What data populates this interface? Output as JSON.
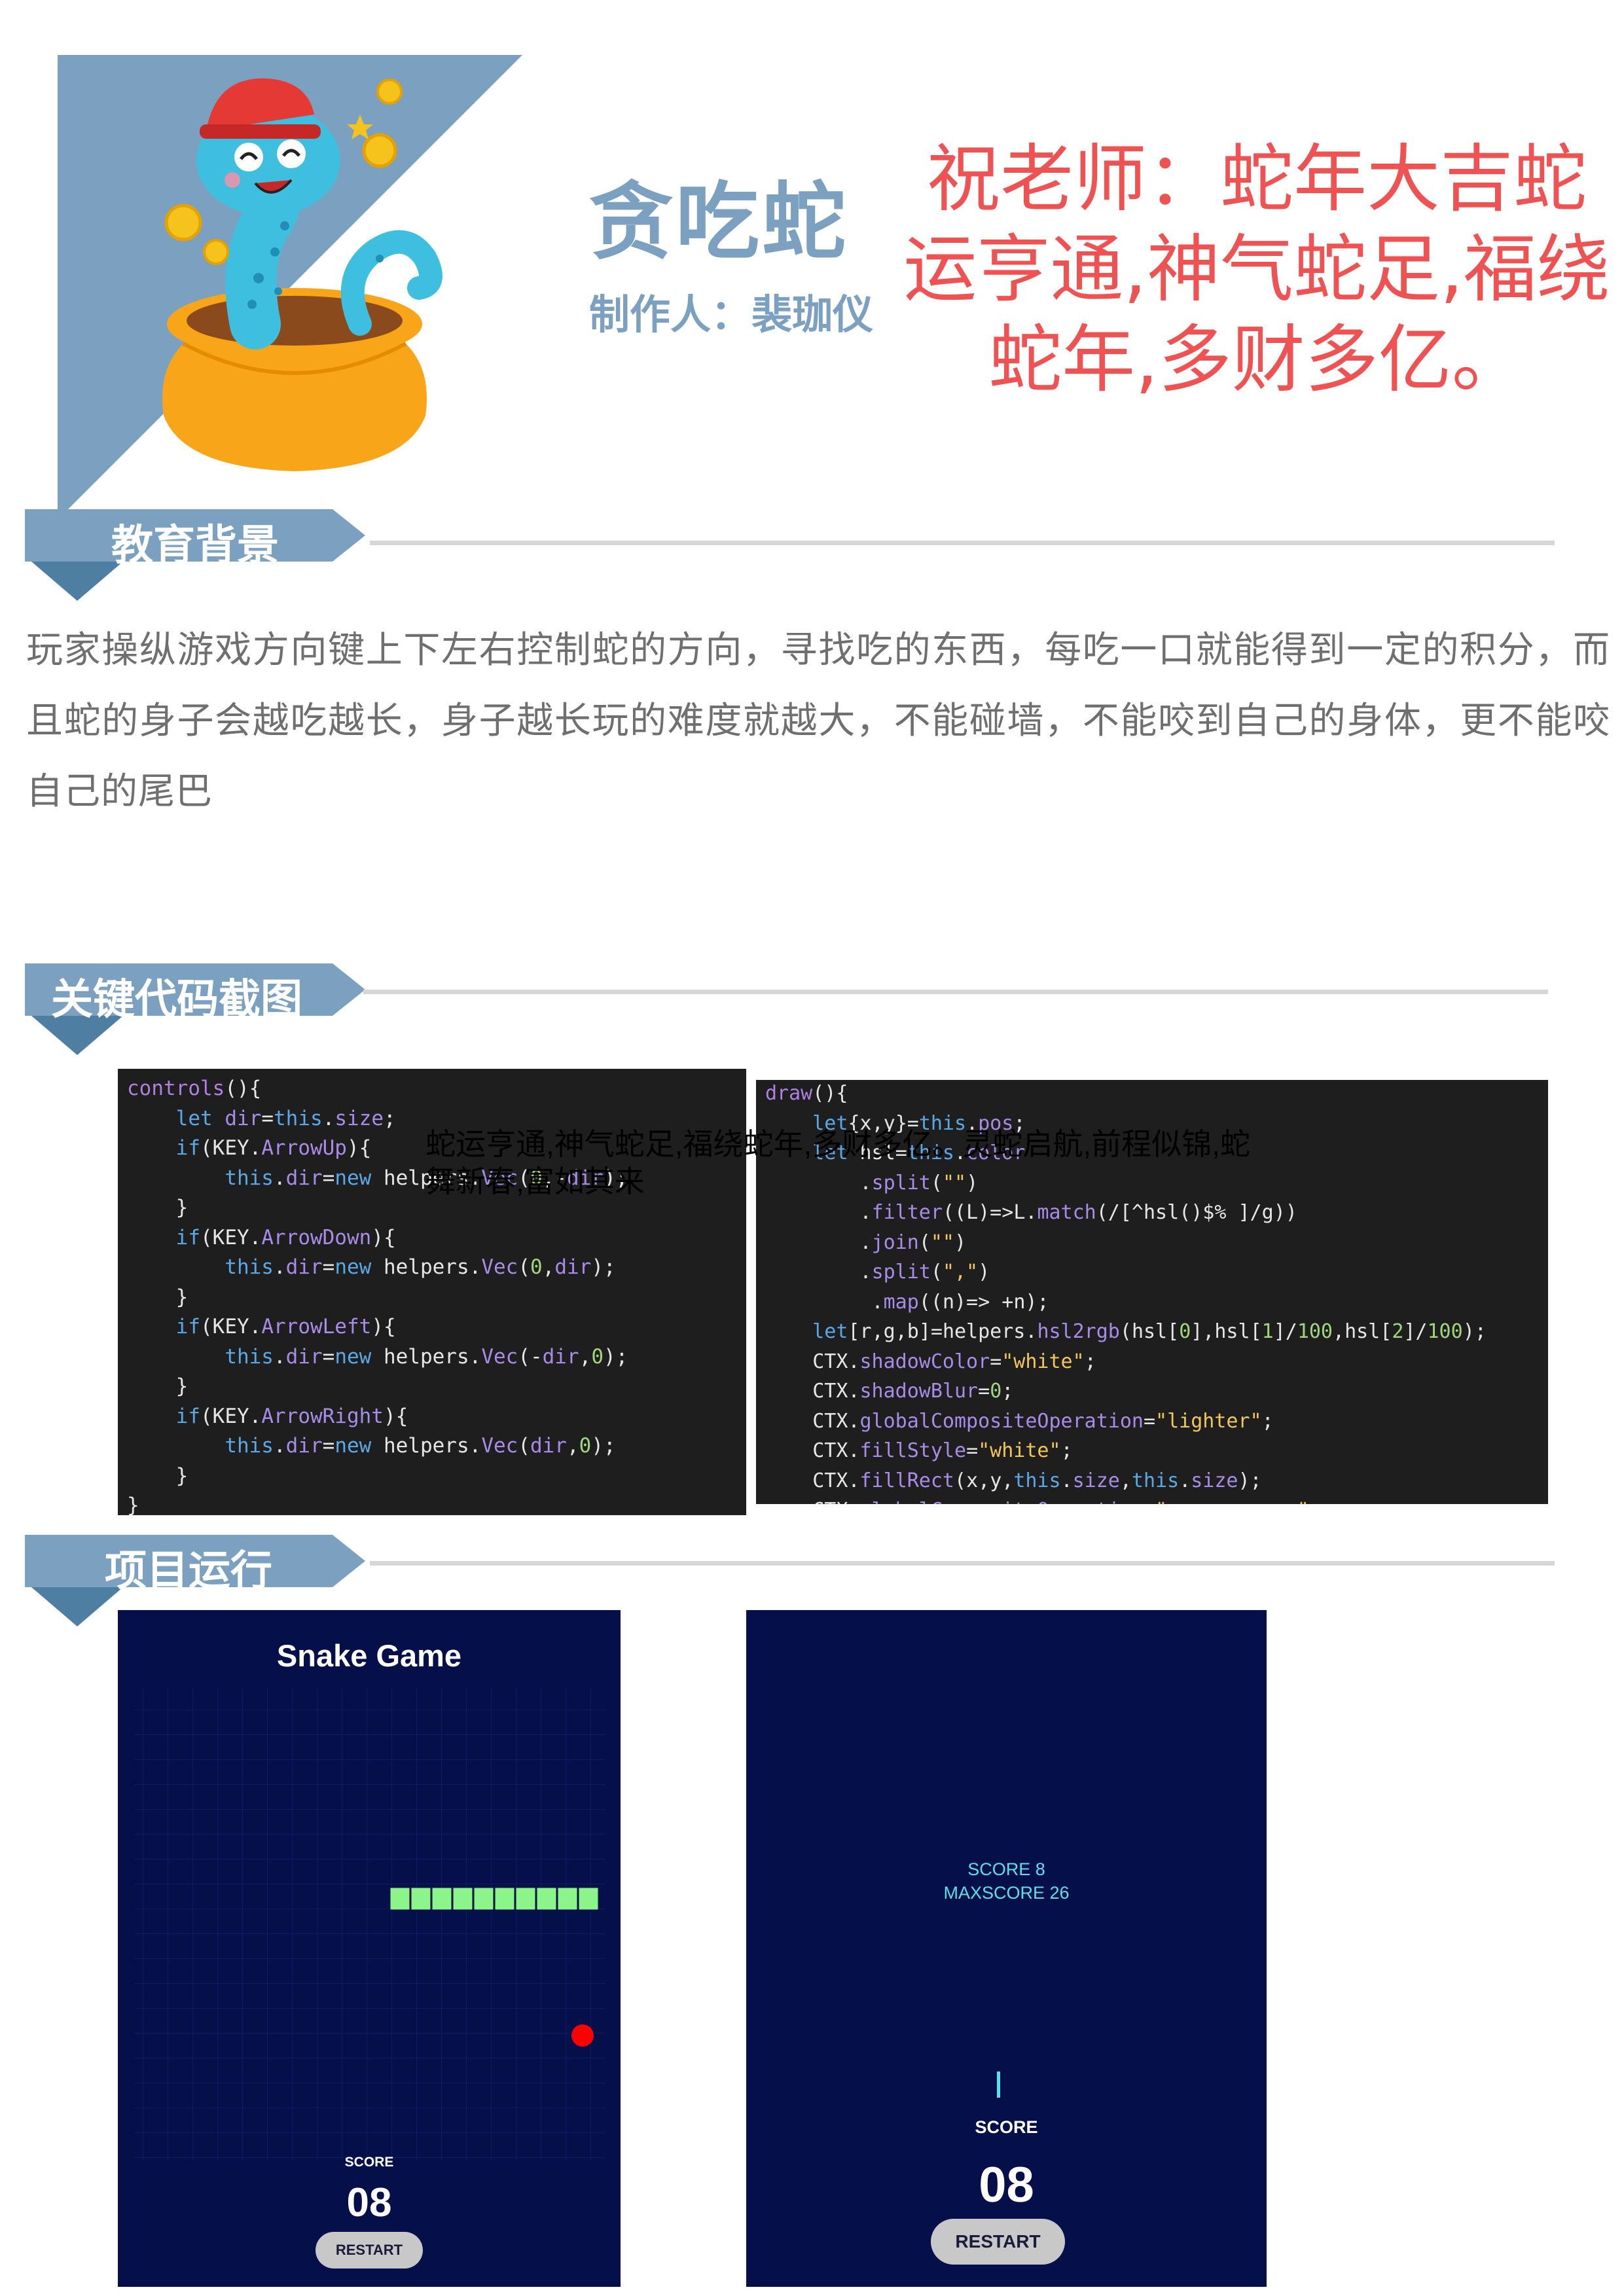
{
  "header": {
    "title": "贪吃蛇",
    "author": "制作人：裴珈仪",
    "greeting_lines": [
      "祝老师：蛇年大吉蛇",
      "运亨通,神气蛇足,福绕",
      "蛇年,多财多亿。"
    ]
  },
  "sections": {
    "education": {
      "label": "教育背景"
    },
    "code": {
      "label": "关键代码截图"
    },
    "run": {
      "label": "项目运行"
    }
  },
  "education_text": "玩家操纵游戏方向键上下左右控制蛇的方向，寻找吃的东西，每吃一口就能得到一定的积分，而且蛇的身子会越吃越长，身子越长玩的难度就越大，不能碰墙，不能咬到自己的身体，更不能咬自己的尾巴",
  "code_left": [
    "controls(){",
    "    let dir=this.size;",
    "    if(KEY.ArrowUp){",
    "        this.dir=new helpers.Vec(0,-dir);",
    "    }",
    "    if(KEY.ArrowDown){",
    "        this.dir=new helpers.Vec(0,dir);",
    "    }",
    "    if(KEY.ArrowLeft){",
    "        this.dir=new helpers.Vec(-dir,0);",
    "    }",
    "    if(KEY.ArrowRight){",
    "        this.dir=new helpers.Vec(dir,0);",
    "    }",
    "}"
  ],
  "code_right": [
    "draw(){",
    "    let{x,y}=this.pos;",
    "    let hsl=this.color",
    "        .split(\"\")",
    "        .filter((L)=>L.match(/[^hsl()$% ]/g))",
    "        .join(\"\")",
    "        .split(\",\")",
    "         .map((n)=> +n);",
    "    let[r,g,b]=helpers.hsl2rgb(hsl[0],hsl[1]/100,hsl[2]/100);",
    "    CTX.shadowColor=\"white\";",
    "    CTX.shadowBlur=0;",
    "    CTX.globalCompositeOperation=\"lighter\";",
    "    CTX.fillStyle=\"white\";",
    "    CTX.fillRect(x,y,this.size,this.size);",
    "    CTX.globalCompositeOperation=\"source-over\";",
    "}"
  ],
  "overlay_text": "蛇运亨通,神气蛇足,福绕蛇年,多财多亿。灵蛇启航,前程似锦,蛇舞新春,富如其来",
  "game_left": {
    "title": "Snake Game",
    "score_label": "SCORE",
    "score_value": "08",
    "restart_label": "RESTART"
  },
  "game_right": {
    "score_line": "SCORE 8",
    "maxscore_line": "MAXSCORE 26",
    "score_label": "SCORE",
    "score_value": "08",
    "restart_label": "RESTART"
  },
  "colors": {
    "accent_blue": "#7ba0c0",
    "banner_dark": "#4f7ea3",
    "greeting_red": "#ee5253",
    "game_bg": "#050f4a",
    "snake_green": "#8cf58a",
    "food_red": "#ff0000",
    "score_cyan": "#5ce0ea"
  }
}
